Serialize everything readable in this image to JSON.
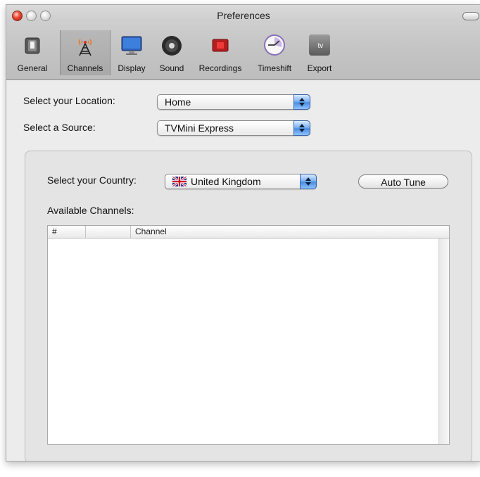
{
  "window": {
    "title": "Preferences"
  },
  "toolbar": {
    "items": [
      {
        "label": "General",
        "icon": "switch-icon"
      },
      {
        "label": "Channels",
        "icon": "antenna-icon",
        "selected": true
      },
      {
        "label": "Display",
        "icon": "monitor-icon"
      },
      {
        "label": "Sound",
        "icon": "speaker-icon"
      },
      {
        "label": "Recordings",
        "icon": "record-icon"
      },
      {
        "label": "Timeshift",
        "icon": "clock-icon"
      },
      {
        "label": "Export",
        "icon": "appletv-icon"
      }
    ],
    "export_icon_text": " tv"
  },
  "location": {
    "label": "Select your Location:",
    "value": "Home"
  },
  "source": {
    "label": "Select a Source:",
    "value": "TVMini Express"
  },
  "country": {
    "label": "Select your Country:",
    "value": "United Kingdom",
    "flag": "uk-flag-icon"
  },
  "auto_tune": {
    "label": "Auto Tune"
  },
  "channels": {
    "heading": "Available Channels:",
    "columns": [
      "#",
      "",
      "Channel"
    ],
    "rows": []
  },
  "colors": {
    "selected_tab": "#a9a9a9",
    "popup_arrows": "#4a8de0",
    "close_button": "#e8432e"
  }
}
